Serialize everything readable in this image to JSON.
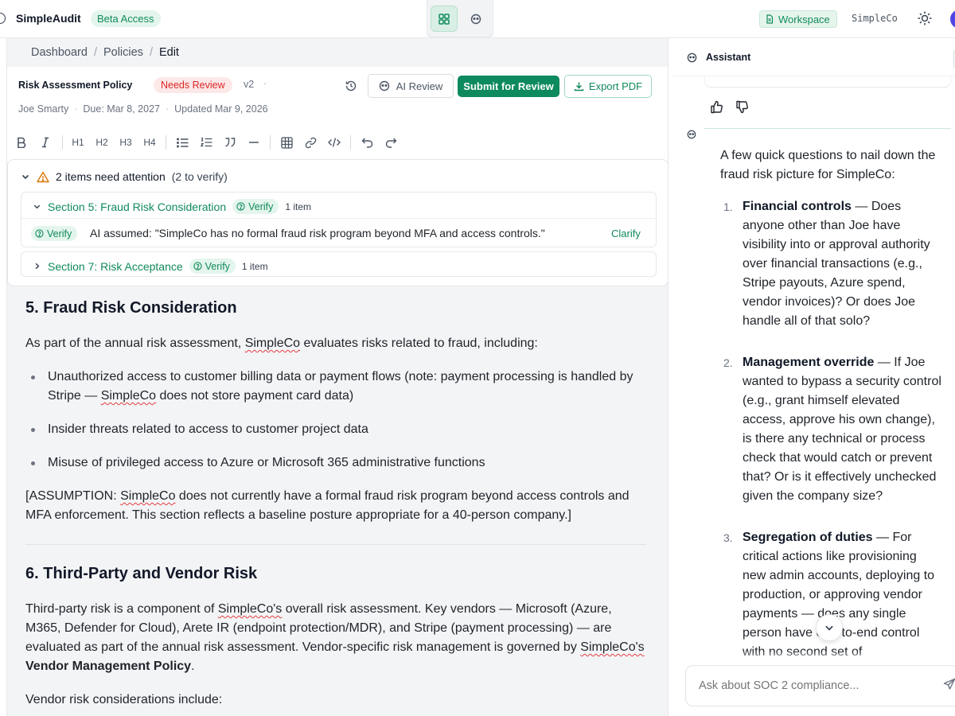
{
  "app": {
    "name": "SimpleAudit",
    "beta_label": "Beta Access",
    "workspace_label": "Workspace",
    "org_name": "SimpleCo"
  },
  "breadcrumb": [
    "Dashboard",
    "Policies",
    "Edit"
  ],
  "document": {
    "title": "Risk Assessment Policy",
    "status": "Needs Review",
    "version": "v2",
    "author": "Joe Smarty",
    "due": "Due: Mar 8, 2027",
    "updated": "Updated Mar 9, 2026"
  },
  "actions": {
    "ai_review": "AI Review",
    "submit": "Submit for Review",
    "export": "Export PDF"
  },
  "toolbar": {
    "h1": "H1",
    "h2": "H2",
    "h3": "H3",
    "h4": "H4"
  },
  "attention": {
    "headline": "2 items need attention",
    "sub": "(2 to verify)",
    "sections": [
      {
        "name": "Section 5: Fraud Risk Consideration",
        "badge": "Verify",
        "count": "1 item",
        "items": [
          {
            "badge": "Verify",
            "text": "AI assumed: \"SimpleCo has no formal fraud risk program beyond MFA and access controls.\"",
            "action": "Clarify"
          }
        ]
      },
      {
        "name": "Section 7: Risk Acceptance",
        "badge": "Verify",
        "count": "1 item"
      }
    ]
  },
  "content": {
    "s5_heading": "5. Fraud Risk Consideration",
    "s5_intro_a": "As part of the annual risk assessment, ",
    "s5_intro_b": "SimpleCo",
    "s5_intro_c": " evaluates risks related to fraud, including:",
    "s5_b1_a": "Unauthorized access to customer billing data or payment flows (note: payment processing is handled by Stripe — ",
    "s5_b1_b": "SimpleCo",
    "s5_b1_c": " does not store payment card data)",
    "s5_b2": "Insider threats related to access to customer project data",
    "s5_b3": "Misuse of privileged access to Azure or Microsoft 365 administrative functions",
    "s5_assumption_a": "[ASSUMPTION: ",
    "s5_assumption_b": "SimpleCo",
    "s5_assumption_c": " does not currently have a formal fraud risk program beyond access controls and MFA enforcement. This section reflects a baseline posture appropriate for a 40-person company.]",
    "s6_heading": "6. Third-Party and Vendor Risk",
    "s6_p1_a": "Third-party risk is a component of ",
    "s6_p1_b": "SimpleCo's",
    "s6_p1_c": " overall risk assessment. Key vendors — Microsoft (Azure, M365, Defender for Cloud), Arete IR (endpoint protection/MDR), and Stripe (payment processing) — are evaluated as part of the annual risk assessment. Vendor-specific risk management is governed by ",
    "s6_p1_d": "SimpleCo's",
    "s6_p1_e": " ",
    "s6_p1_f": "Vendor Management Policy",
    "s6_p1_g": ".",
    "s6_p2": "Vendor risk considerations include:"
  },
  "assistant": {
    "title": "Assistant",
    "intro": "A few quick questions to nail down the fraud risk picture for SimpleCo:",
    "items": [
      {
        "num": "1.",
        "title": "Financial controls",
        "body": " — Does anyone other than Joe have visibility into or approval authority over financial transactions (e.g., Stripe payouts, Azure spend, vendor invoices)? Or does Joe handle all of that solo?"
      },
      {
        "num": "2.",
        "title": "Management override",
        "body": " — If Joe wanted to bypass a security control (e.g., grant himself elevated access, approve his own change), is there any technical or process check that would catch or prevent that? Or is it effectively unchecked given the company size?"
      },
      {
        "num": "3.",
        "title": "Segregation of duties",
        "body": " — For critical actions like provisioning new admin accounts, deploying to production, or approving vendor payments — does any single person have end-to-end control with no second set of"
      }
    ],
    "input_placeholder": "Ask about SOC 2 compliance..."
  },
  "colors": {
    "brand_green": "#0e8a5f",
    "needs_review_red": "#dc2626",
    "warning_amber": "#d97706"
  }
}
